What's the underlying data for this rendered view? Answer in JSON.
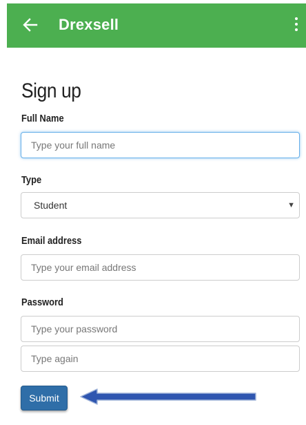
{
  "appbar": {
    "title": "Drexsell",
    "color": "#4caf50",
    "back_icon": "arrow-left-icon",
    "menu_icon": "more-vertical-icon"
  },
  "form": {
    "title": "Sign up",
    "full_name": {
      "label": "Full Name",
      "placeholder": "Type your full name",
      "value": ""
    },
    "type": {
      "label": "Type",
      "selected": "Student",
      "arrow_icon": "caret-down-icon"
    },
    "email": {
      "label": "Email address",
      "placeholder": "Type your email address",
      "value": ""
    },
    "password": {
      "label": "Password",
      "placeholder": "Type your password",
      "confirm_placeholder": "Type again"
    },
    "submit_label": "Submit"
  },
  "annotation": {
    "arrow_icon": "arrow-left-annotation-icon",
    "colors": {
      "fill": "#2f56b0",
      "stroke": "#9fb3d9"
    }
  }
}
